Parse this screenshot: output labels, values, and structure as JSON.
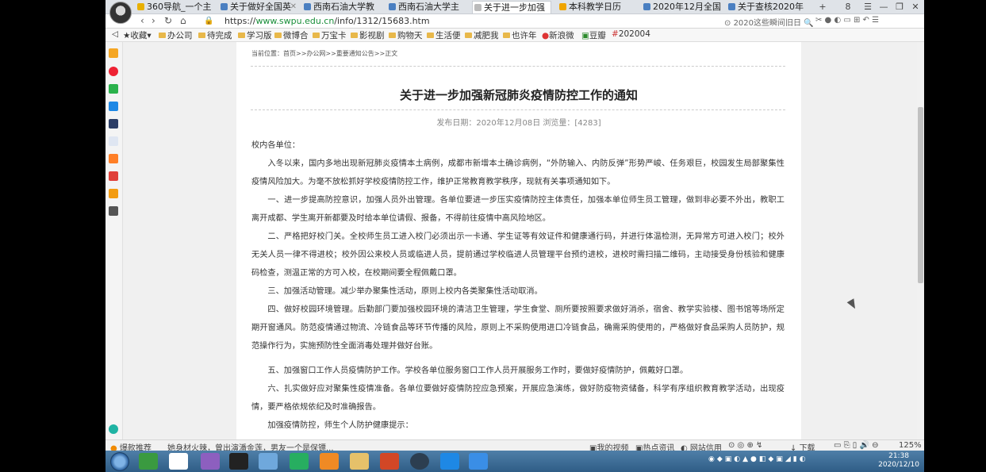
{
  "browser": {
    "tabs": [
      {
        "label": "360导航_一个主"
      },
      {
        "label": "关于做好全国英"
      },
      {
        "label": "西南石油大学教"
      },
      {
        "label": "西南石油大学主"
      },
      {
        "label": "关于进一步加强"
      },
      {
        "label": "本科教学日历"
      },
      {
        "label": "2020年12月全国"
      },
      {
        "label": "关于查核2020年"
      }
    ],
    "tab_count": "8",
    "url_prefix": "https://",
    "url_host": "www.swpu.edu.cn",
    "url_path": "/info/1312/15683.htm",
    "search_hint": "2020这些瞬间旧日",
    "bookmarks": [
      "收藏",
      "办公司",
      "待完成",
      "学习版",
      "微博合",
      "万宝卡",
      "影视剧",
      "购物天",
      "生活便",
      "减肥我",
      "也许年",
      "新浪微",
      "豆瓣",
      "202004"
    ]
  },
  "article": {
    "breadcrumb": "当前位置：首页>>办公网>>重要通知公告>>正文",
    "title": "关于进一步加强新冠肺炎疫情防控工作的通知",
    "meta": "发布日期：2020年12月08日    浏览量：[4283]",
    "salutation": "校内各单位：",
    "paragraphs": [
      "入冬以来，国内多地出现新冠肺炎疫情本土病例，成都市新增本土确诊病例，“外防输入、内防反弹”形势严峻、任务艰巨，校园发生局部聚集性疫情风险加大。为毫不放松抓好学校疫情防控工作，维护正常教育教学秩序，现就有关事项通知如下。",
      "一、进一步提高防控意识，加强人员外出管理。各单位要进一步压实疫情防控主体责任，加强本单位师生员工管理，做到非必要不外出，教职工离开成都、学生离开新都要及时给本单位请假、报备，不得前往疫情中高风险地区。",
      "二、严格把好校门关。全校师生员工进入校门必须出示一卡通、学生证等有效证件和健康通行码，并进行体温检测，无异常方可进入校门；校外无关人员一律不得进校；校外因公来校人员或临进人员，提前通过学校临进人员管理平台预约进校，进校时需扫描二维码，主动接受身份核验和健康码检查，测温正常的方可入校，在校期间要全程佩戴口罩。",
      "三、加强活动管理。减少举办聚集性活动，原则上校内各类聚集性活动取消。",
      "四、做好校园环境管理。后勤部门要加强校园环境的清洁卫生管理，学生食堂、厕所要按照要求做好消杀，宿舍、教学实验楼、图书馆等场所定期开窗通风。防范疫情通过物流、冷链食品等环节传播的风险，原则上不采购使用进口冷链食品，确需采购使用的，严格做好食品采购人员防护，规范操作行为，实施预防性全面消毒处理并做好台账。",
      "五、加强窗口工作人员疫情防护工作。学校各单位服务窗口工作人员开展服务工作时，要做好疫情防护，佩戴好口罩。",
      "六、扎实做好应对聚集性疫情准备。各单位要做好疫情防控应急预案，开展应急演练，做好防疫物资储备，科学有序组织教育教学活动，出现疫情，要严格依规依纪及时准确报告。",
      "加强疫情防控，师生个人防护健康提示："
    ]
  },
  "status": {
    "left1": "爆款推荐",
    "left2": "她身材火辣，曾出演潘金莲，男友一个是保镖...",
    "my_video": "我的视频",
    "hot": "热点资讯",
    "bank": "网站信用",
    "download": "下载",
    "zoom": "125%"
  },
  "taskbar": {
    "time": "21:38",
    "date": "2020/12/10"
  }
}
